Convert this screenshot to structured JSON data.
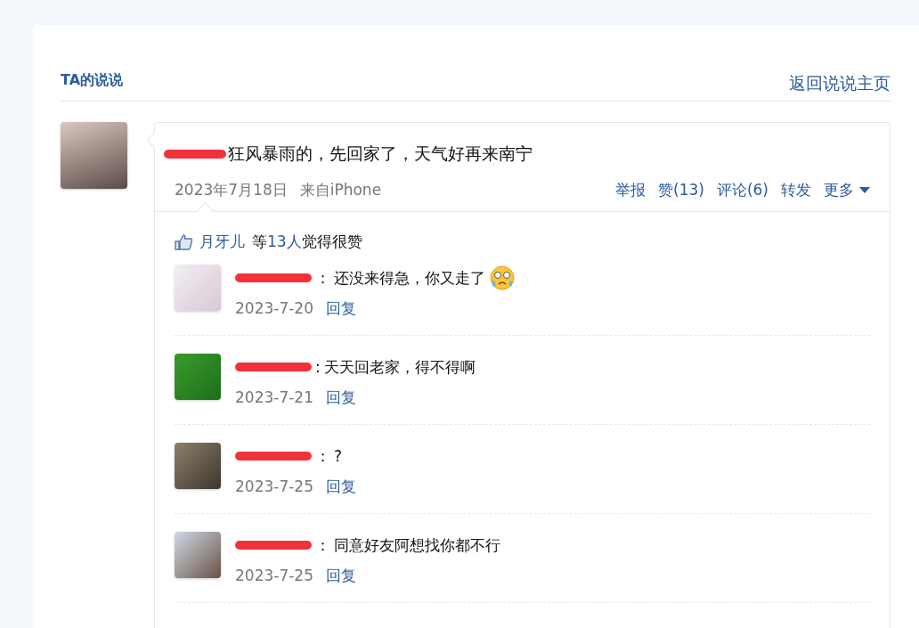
{
  "header": {
    "title": "TA的说说",
    "back_link": "返回说说主页"
  },
  "post": {
    "text": "狂风暴雨的，先回家了，天气好再来南宁",
    "date": "2023年7月18日",
    "source": "来自iPhone",
    "actions": [
      "举报",
      "赞(13)",
      "评论(6)",
      "转发"
    ],
    "more": "更多"
  },
  "likes": {
    "liker": "月牙儿",
    "prefix": "等",
    "count": "13人",
    "suffix": "觉得很赞"
  },
  "comments": [
    {
      "separator": "：",
      "text": "还没来得急，你又走了",
      "emoji": true,
      "date": "2023-7-20",
      "reply": "回复"
    },
    {
      "separator": ":",
      "text": "天天回老家，得不得啊",
      "emoji": false,
      "date": "2023-7-21",
      "reply": "回复"
    },
    {
      "separator": "：",
      "text": "?",
      "emoji": false,
      "date": "2023-7-25",
      "reply": "回复"
    },
    {
      "separator": "：",
      "text": "同意好友阿想找你都不行",
      "emoji": false,
      "date": "2023-7-25",
      "reply": "回复"
    }
  ]
}
